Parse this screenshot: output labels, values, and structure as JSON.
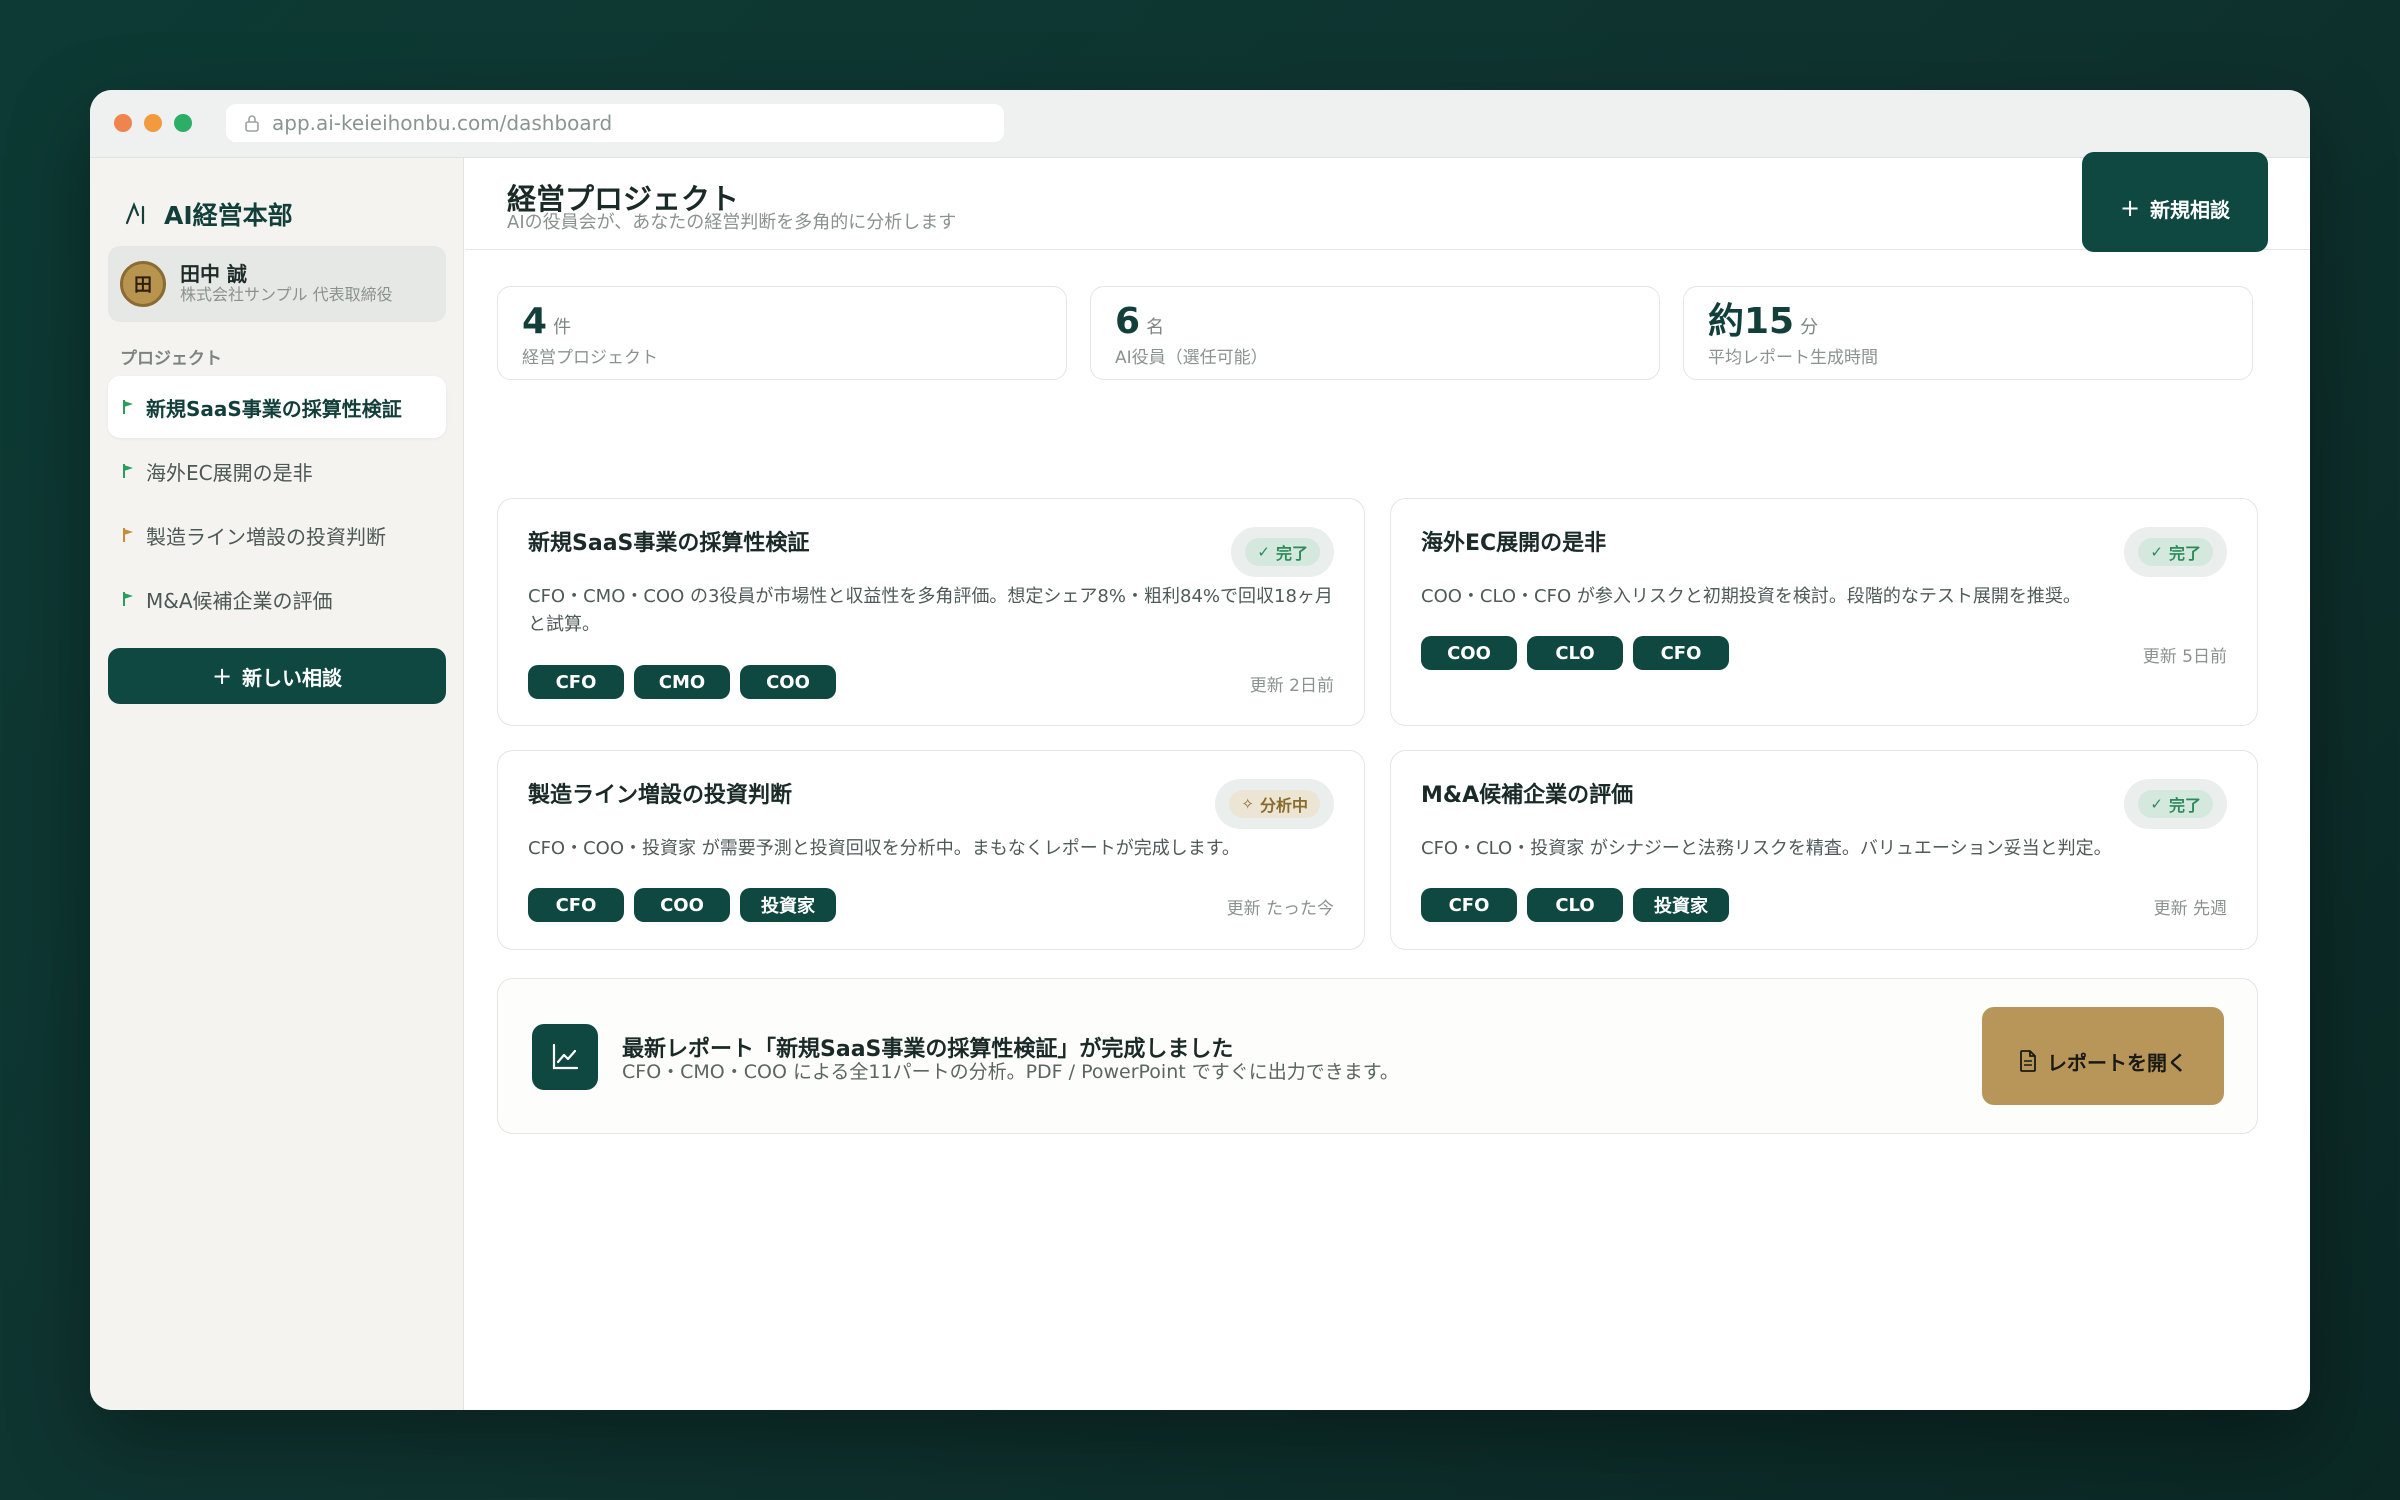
{
  "browser": {
    "url": "app.ai-keieihonbu.com/dashboard"
  },
  "sidebar": {
    "brand": "AI経営本部",
    "user": {
      "initial": "田",
      "name": "田中 誠",
      "org": "株式会社サンプル 代表取締役"
    },
    "section_label": "プロジェクト",
    "items": [
      {
        "label": "新規SaaS事業の採算性検証",
        "flag_color": "#2a9d5c"
      },
      {
        "label": "海外EC展開の是非",
        "flag_color": "#2a9d5c"
      },
      {
        "label": "製造ライン増設の投資判断",
        "flag_color": "#c98a3a"
      },
      {
        "label": "M&A候補企業の評価",
        "flag_color": "#2a9d5c"
      }
    ],
    "new_button": "新しい相談"
  },
  "header": {
    "title": "経営プロジェクト",
    "subtitle": "AIの役員会が、あなたの経営判断を多角的に分析します",
    "new_button": "新規相談"
  },
  "stats": [
    {
      "value": "4",
      "unit": "件",
      "label": "経営プロジェクト"
    },
    {
      "value": "6",
      "unit": "名",
      "label": "AI役員（選任可能）"
    },
    {
      "value": "約15",
      "unit": "分",
      "label": "平均レポート生成時間"
    }
  ],
  "projects": [
    {
      "title": "新規SaaS事業の採算性検証",
      "status": "完了",
      "desc": "CFO・CMO・COO の3役員が市場性と収益性を多角評価。想定シェア8%・粗利84%で回収18ヶ月と試算。",
      "tags": [
        "CFO",
        "CMO",
        "COO"
      ],
      "updated": "更新 2日前"
    },
    {
      "title": "海外EC展開の是非",
      "status": "完了",
      "desc": "COO・CLO・CFO が参入リスクと初期投資を検討。段階的なテスト展開を推奨。",
      "tags": [
        "COO",
        "CLO",
        "CFO"
      ],
      "updated": "更新 5日前"
    },
    {
      "title": "製造ライン増設の投資判断",
      "status": "分析中",
      "desc": "CFO・COO・投資家 が需要予測と投資回収を分析中。まもなくレポートが完成します。",
      "tags": [
        "CFO",
        "COO",
        "投資家"
      ],
      "updated": "更新 たった今"
    },
    {
      "title": "M&A候補企業の評価",
      "status": "完了",
      "desc": "CFO・CLO・投資家 がシナジーと法務リスクを精査。バリュエーション妥当と判定。",
      "tags": [
        "CFO",
        "CLO",
        "投資家"
      ],
      "updated": "更新 先週"
    }
  ],
  "banner": {
    "title": "最新レポート「新規SaaS事業の採算性検証」が完成しました",
    "text": "CFO・CMO・COO による全11パートの分析。PDF / PowerPoint ですぐに出力できます。",
    "button": "レポートを開く"
  },
  "colors": {
    "primary": "#0f4741",
    "accent_gold": "#b8965a",
    "status_done": "#2d8a5a",
    "status_wip": "#8a6b2e"
  }
}
